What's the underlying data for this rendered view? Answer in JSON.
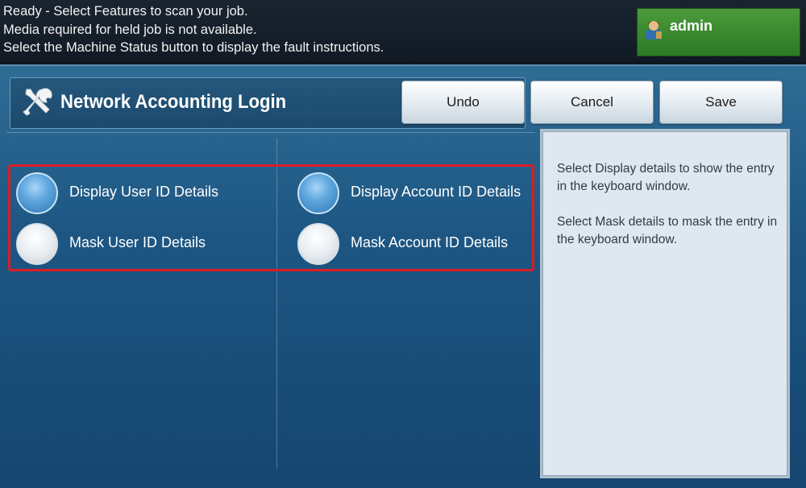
{
  "status_bar": {
    "lines": [
      "Ready -  Select Features to scan your job.",
      "Media required for held job is not available.",
      "Select the Machine Status button to display the fault instructions."
    ],
    "user": "admin"
  },
  "header": {
    "title": "Network Accounting Login",
    "icon": "tools-icon",
    "buttons": {
      "undo": "Undo",
      "cancel": "Cancel",
      "save": "Save"
    }
  },
  "options": {
    "user_id": {
      "display": {
        "label": "Display User ID Details",
        "selected": true
      },
      "mask": {
        "label": "Mask User ID Details",
        "selected": false
      }
    },
    "account_id": {
      "display": {
        "label": "Display Account ID Details",
        "selected": true
      },
      "mask": {
        "label": "Mask Account ID Details",
        "selected": false
      }
    }
  },
  "help": {
    "paragraphs": [
      "Select Display details to show the entry\nin the keyboard window.",
      "Select Mask details to mask the entry in\n the keyboard window."
    ]
  },
  "colors": {
    "highlight": "#d91e27",
    "user_button": "#3f8f34",
    "panel": "#1d5683"
  }
}
